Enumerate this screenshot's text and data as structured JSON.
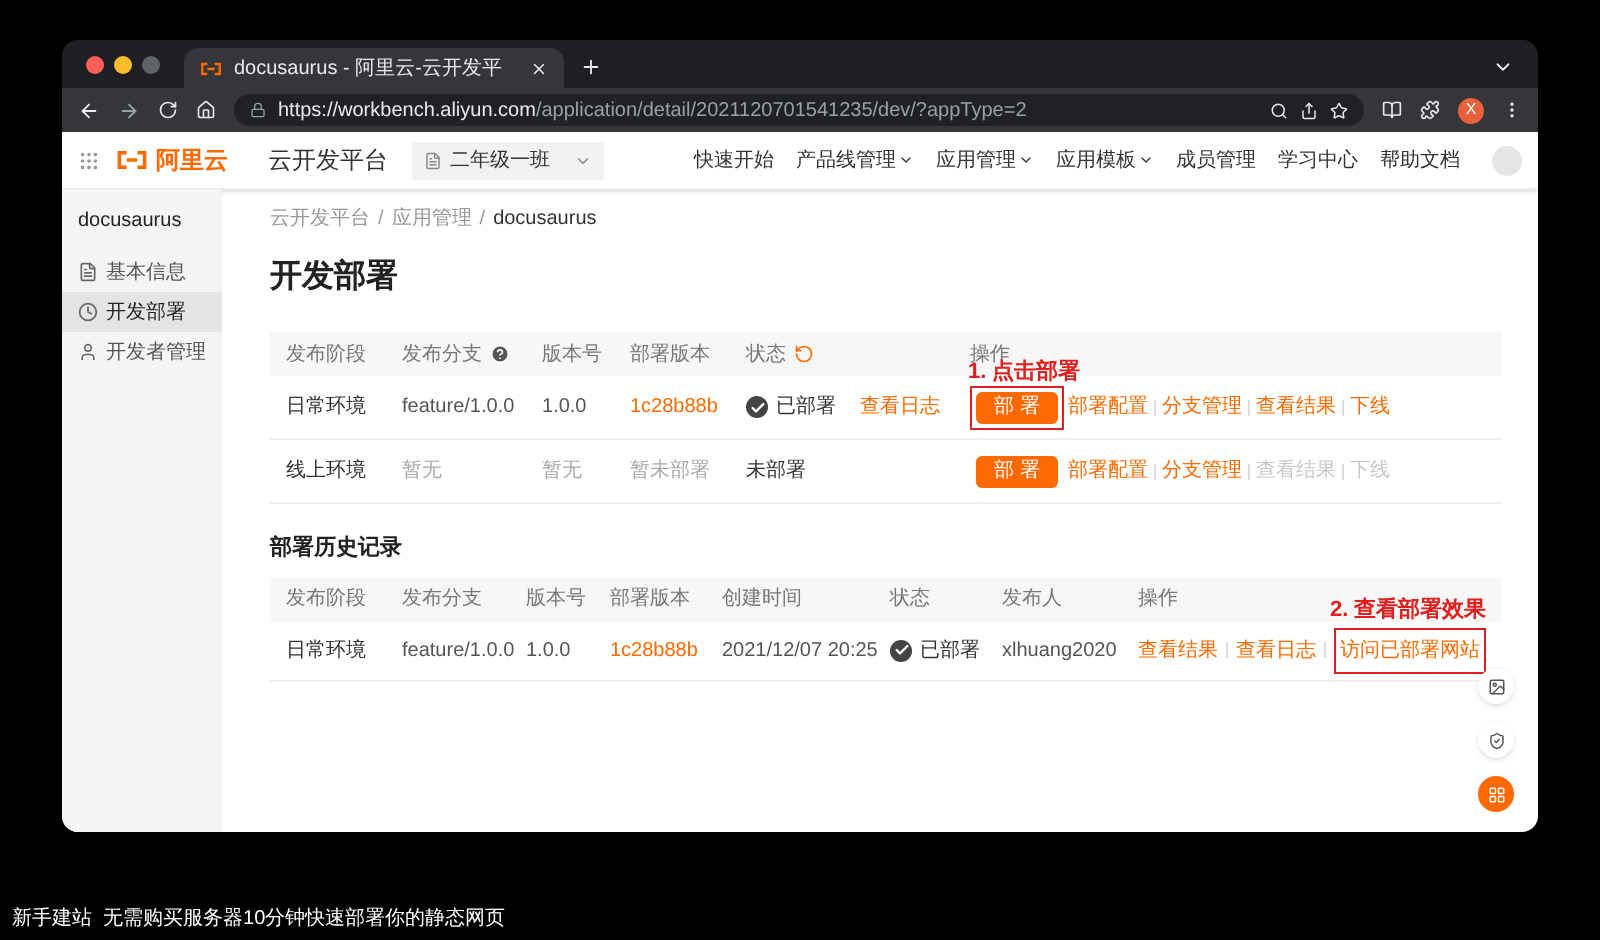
{
  "browser": {
    "tab_title": "docusaurus - 阿里云-云开发平",
    "url_host": "https://workbench.aliyun.com",
    "url_path": "/application/detail/2021120701541235/dev/?appType=2",
    "profile": "X"
  },
  "header": {
    "logo": "阿里云",
    "product": "云开发平台",
    "project": "二年级一班",
    "nav": [
      {
        "label": "快速开始",
        "dropdown": false
      },
      {
        "label": "产品线管理",
        "dropdown": true
      },
      {
        "label": "应用管理",
        "dropdown": true
      },
      {
        "label": "应用模板",
        "dropdown": true
      },
      {
        "label": "成员管理",
        "dropdown": false
      },
      {
        "label": "学习中心",
        "dropdown": false
      },
      {
        "label": "帮助文档",
        "dropdown": false
      }
    ]
  },
  "sidebar": {
    "title": "docusaurus",
    "items": [
      {
        "label": "基本信息",
        "selected": false
      },
      {
        "label": "开发部署",
        "selected": true
      },
      {
        "label": "开发者管理",
        "selected": false
      }
    ]
  },
  "breadcrumb": {
    "separator": "/",
    "items": [
      "云开发平台",
      "应用管理",
      "docusaurus"
    ]
  },
  "page_title": "开发部署",
  "deploy_table": {
    "columns": [
      "发布阶段",
      "发布分支",
      "版本号",
      "部署版本",
      "状态",
      "操作"
    ],
    "annotation": "1. 点击部署",
    "rows": [
      {
        "stage": "日常环境",
        "has_data": true,
        "branch": "feature/1.0.0",
        "version": "1.0.0",
        "commit": "1c28b88b",
        "status": "已部署",
        "deployed": true,
        "log_link": "查看日志",
        "button": "部 署",
        "highlighted": true,
        "actions": [
          {
            "label": "部署配置",
            "disabled": false
          },
          {
            "label": "分支管理",
            "disabled": false
          },
          {
            "label": "查看结果",
            "disabled": false
          },
          {
            "label": "下线",
            "disabled": false
          }
        ]
      },
      {
        "stage": "线上环境",
        "has_data": false,
        "branch": "暂无",
        "version": "暂无",
        "commit": "暂未部署",
        "status": "未部署",
        "deployed": false,
        "button": "部 署",
        "highlighted": false,
        "actions": [
          {
            "label": "部署配置",
            "disabled": false
          },
          {
            "label": "分支管理",
            "disabled": false
          },
          {
            "label": "查看结果",
            "disabled": true
          },
          {
            "label": "下线",
            "disabled": true
          }
        ]
      }
    ]
  },
  "history": {
    "title": "部署历史记录",
    "columns": [
      "发布阶段",
      "发布分支",
      "版本号",
      "部署版本",
      "创建时间",
      "状态",
      "发布人",
      "操作"
    ],
    "annotation": "2. 查看部署效果",
    "rows": [
      {
        "stage": "日常环境",
        "branch": "feature/1.0.0",
        "version": "1.0.0",
        "commit": "1c28b88b",
        "created": "2021/12/07 20:25",
        "status": "已部署",
        "deployed": true,
        "publisher": "xlhuang2020",
        "actions": [
          {
            "label": "查看结果",
            "highlighted": false
          },
          {
            "label": "查看日志",
            "highlighted": false
          },
          {
            "label": "访问已部署网站",
            "highlighted": true
          }
        ]
      }
    ]
  },
  "caption": "新手建站  无需购买服务器10分钟快速部署你的静态网页"
}
